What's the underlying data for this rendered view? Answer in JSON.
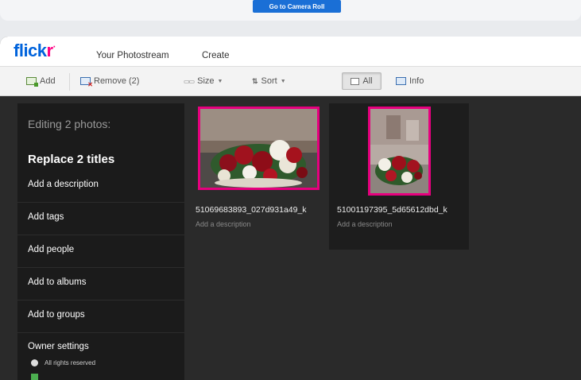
{
  "banner": {
    "camera_roll_label": "Go to Camera Roll"
  },
  "header": {
    "logo": {
      "blue": "flick",
      "pink": "r"
    },
    "nav": [
      "Your Photostream",
      "Create"
    ]
  },
  "toolbar": {
    "add": "Add",
    "remove": "Remove (2)",
    "size": "Size",
    "sort": "Sort",
    "all": "All",
    "info": "Info"
  },
  "sidebar": {
    "title": "Editing 2 photos:",
    "replace_titles": "Replace 2 titles",
    "items": [
      "Add a description",
      "Add tags",
      "Add people",
      "Add to albums",
      "Add to groups"
    ],
    "owner_settings": "Owner settings",
    "rights": "All rights reserved"
  },
  "photos": [
    {
      "name": "51069683893_027d931a49_k",
      "description": "Add a description"
    },
    {
      "name": "51001197395_5d65612dbd_k",
      "description": "Add a description"
    }
  ],
  "colors": {
    "flickr_blue": "#0063dc",
    "flickr_pink": "#ff0084",
    "selection": "#e6007e",
    "button_blue": "#1a6fd6"
  }
}
